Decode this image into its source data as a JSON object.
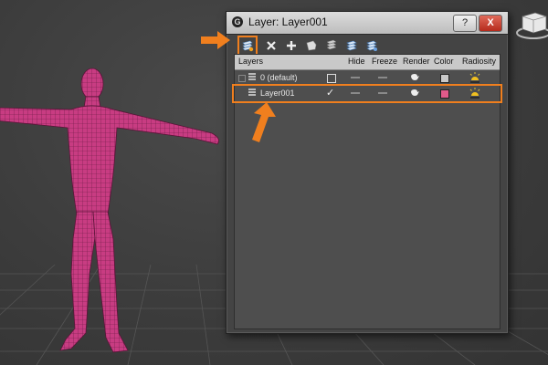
{
  "dialog": {
    "title": "Layer: Layer001",
    "help_label": "?",
    "close_label": "X",
    "app_logo": "G"
  },
  "toolbar": {
    "tools": [
      "create-new-layer-icon",
      "delete-layer-icon",
      "add-selection-icon",
      "select-objects-icon",
      "highlight-layer-icon",
      "hide-all-icon",
      "freeze-all-icon"
    ]
  },
  "layer_table": {
    "headers": {
      "layers": "Layers",
      "hide": "Hide",
      "freeze": "Freeze",
      "render": "Render",
      "color": "Color",
      "radiosity": "Radiosity"
    },
    "rows": [
      {
        "name": "0 (default)",
        "active": false,
        "color": "#c8c8c8"
      },
      {
        "name": "Layer001",
        "active": true,
        "color": "#e05a8a"
      }
    ]
  },
  "colors": {
    "highlight": "#f07f1e",
    "mesh": "#c83c82",
    "background": "#3c3c3c"
  }
}
